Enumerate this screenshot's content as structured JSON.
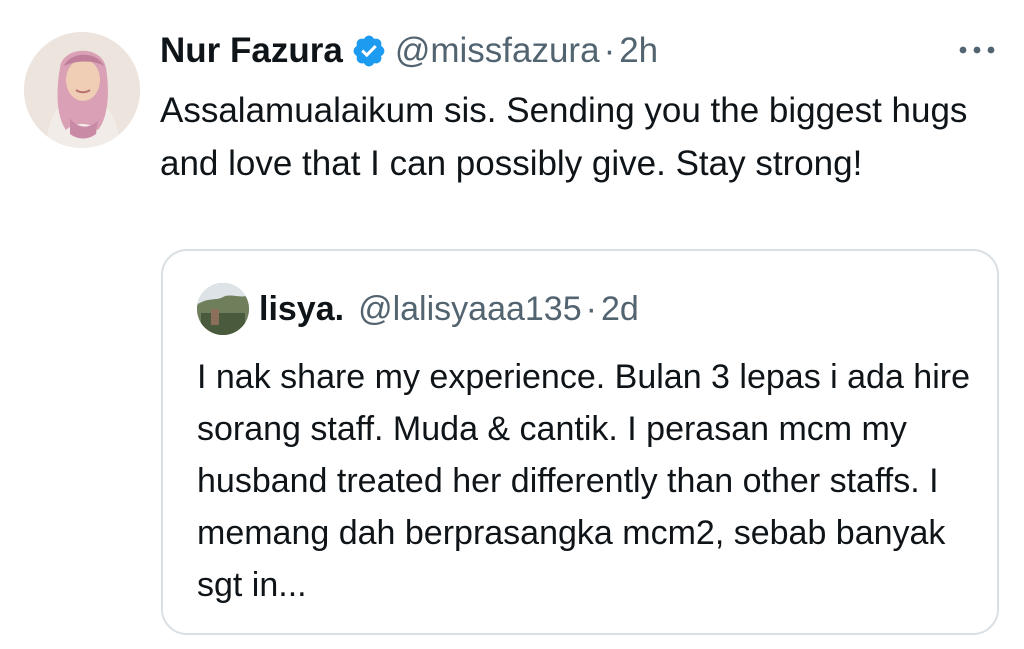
{
  "tweet": {
    "author": {
      "display_name": "Nur Fazura",
      "handle": "@missfazura",
      "verified": true,
      "avatar_icon": "profile-photo-woman-pink-hijab"
    },
    "separator": "·",
    "time": "2h",
    "more_icon": "more-horizontal-icon",
    "text": "Assalamualaikum sis. Sending you the biggest hugs and love that I can possibly give. Stay strong!",
    "colors": {
      "verified_blue": "#1d9bf0",
      "secondary_text": "#536471",
      "border": "#d9dfe3"
    }
  },
  "quote": {
    "author": {
      "display_name": "lisya.",
      "handle": "@lalisyaaa135",
      "avatar_icon": "profile-photo-outdoor"
    },
    "separator": "·",
    "time": "2d",
    "text": "I nak share my experience. Bulan 3 lepas i ada hire sorang staff. Muda & cantik. I perasan mcm my husband treated her differently than other staffs. I memang dah berprasangka mcm2, sebab banyak sgt in..."
  }
}
